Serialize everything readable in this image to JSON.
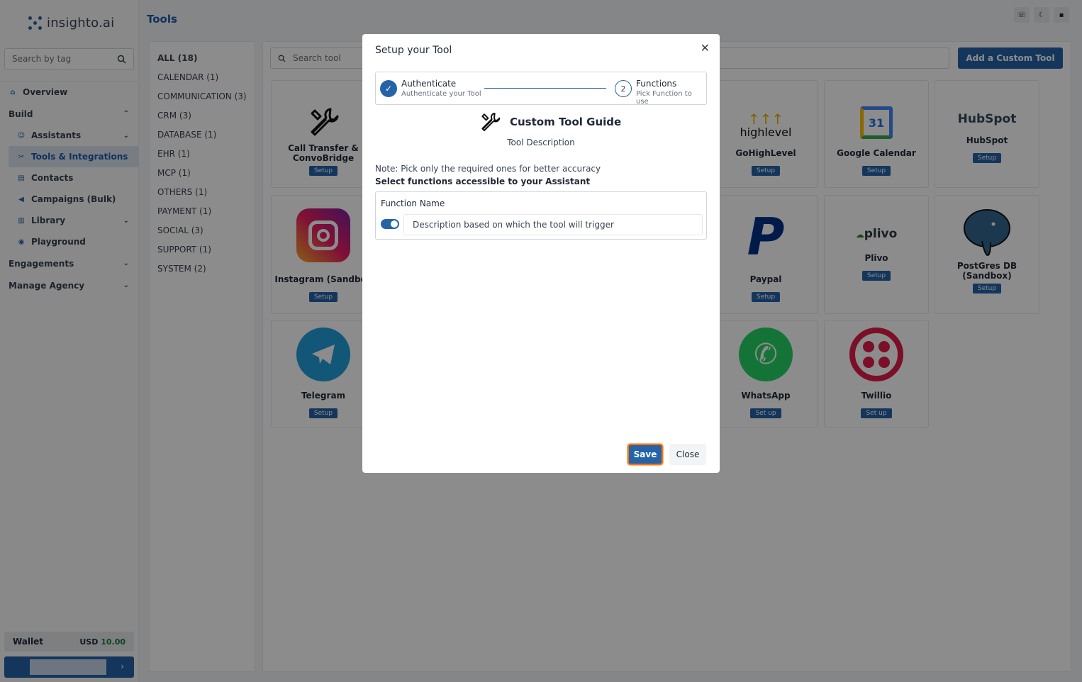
{
  "app": {
    "logo": "insighto.ai"
  },
  "sidebar": {
    "search_placeholder": "Search by tag",
    "items": [
      {
        "label": "Overview"
      },
      {
        "label": "Build"
      },
      {
        "label": "Assistants"
      },
      {
        "label": "Tools & Integrations"
      },
      {
        "label": "Contacts"
      },
      {
        "label": "Campaigns (Bulk)"
      },
      {
        "label": "Library"
      },
      {
        "label": "Playground"
      },
      {
        "label": "Engagements"
      },
      {
        "label": "Manage Agency"
      }
    ],
    "wallet": {
      "label": "Wallet",
      "currency": "USD",
      "amount": "10.00"
    }
  },
  "page": {
    "title": "Tools"
  },
  "categories": [
    "ALL (18)",
    "CALENDAR (1)",
    "COMMUNICATION (3)",
    "CRM (3)",
    "DATABASE (1)",
    "EHR (1)",
    "MCP (1)",
    "OTHERS (1)",
    "PAYMENT (1)",
    "SOCIAL (3)",
    "SUPPORT (1)",
    "SYSTEM (2)"
  ],
  "tools": {
    "search_placeholder": "Search tool",
    "add_button": "Add a Custom Tool",
    "cards": [
      {
        "name": "Call Transfer & ConvoBridge",
        "action": "Setup"
      },
      {
        "name": "GoHighLevel",
        "action": "Setup",
        "logo_text": "highlevel"
      },
      {
        "name": "Google Calendar",
        "action": "Setup",
        "logo_text": "31"
      },
      {
        "name": "HubSpot",
        "action": "Setup",
        "logo_text": "HubSpot"
      },
      {
        "name": "Instagram (Sandbox",
        "action": "Setup"
      },
      {
        "name": "Paypal",
        "action": "Setup"
      },
      {
        "name": "Plivo",
        "action": "Setup",
        "logo_text": "plivo"
      },
      {
        "name": "PostGres DB (Sandbox)",
        "action": "Setup"
      },
      {
        "name": "Telegram",
        "action": "Setup"
      },
      {
        "name": "WhatsApp",
        "action": "Set up"
      },
      {
        "name": "Twillio",
        "action": "Set up"
      }
    ]
  },
  "modal": {
    "title": "Setup your Tool",
    "step1": {
      "title": "Authenticate",
      "subtitle": "Authenticate your Tool"
    },
    "step2": {
      "number": "2",
      "title": "Functions",
      "subtitle": "Pick Function to use"
    },
    "guide_title": "Custom Tool Guide",
    "guide_desc": "Tool Description",
    "note": "Note: Pick only the required ones for better accuracy",
    "note2": "Select functions accessible to your Assistant",
    "function_label": "Function Name",
    "function_desc": "Description based on which the tool will trigger",
    "save": "Save",
    "close": "Close"
  },
  "colors": {
    "accent": "#2563a8",
    "highlight": "#f97316"
  }
}
